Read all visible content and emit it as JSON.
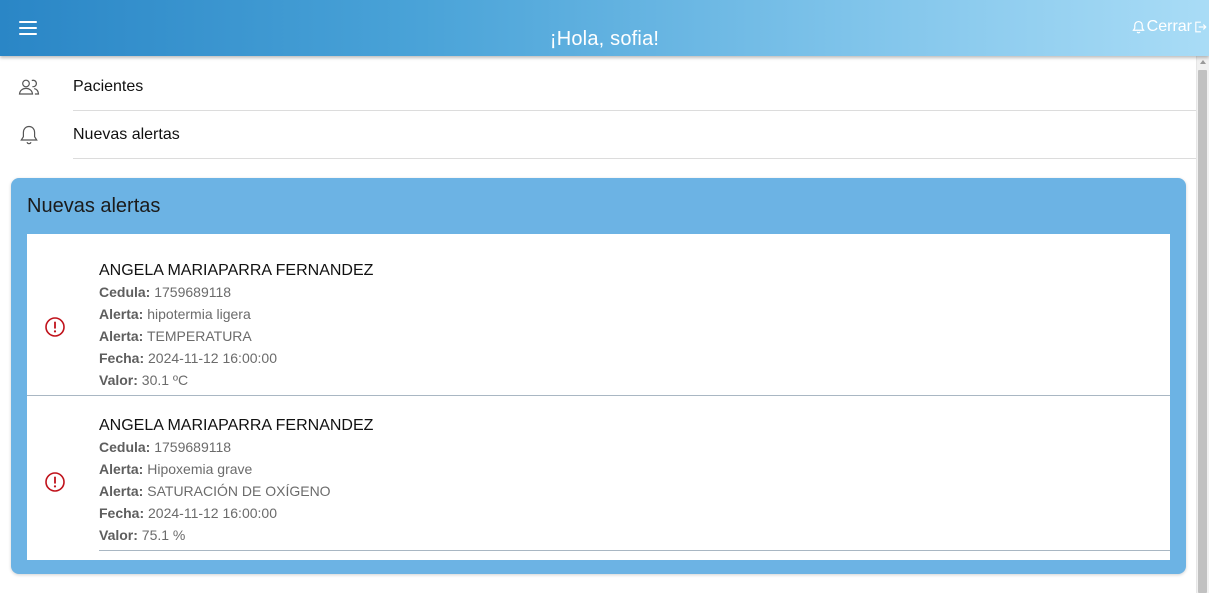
{
  "header": {
    "greeting": "¡Hola, sofia!",
    "logout_label": "Cerrar",
    "colors": {
      "gradient_start": "#2a86c6",
      "gradient_end": "#a9dcf6"
    }
  },
  "nav": {
    "items": [
      {
        "label": "Pacientes",
        "icon": "users-icon"
      },
      {
        "label": "Nuevas alertas",
        "icon": "bell-icon"
      }
    ]
  },
  "alerts_panel": {
    "title": "Nuevas alertas",
    "accent_color": "#6cb3e4",
    "alert_icon_color": "#c0121b",
    "alerts": [
      {
        "patient": "ANGELA MARIAPARRA FERNANDEZ",
        "cedula_label": "Cedula:",
        "cedula": "1759689118",
        "alerta_label": "Alerta:",
        "alerta": "hipotermia ligera",
        "tipo_label": "Alerta:",
        "tipo": "TEMPERATURA",
        "fecha_label": "Fecha:",
        "fecha": "2024-11-12 16:00:00",
        "valor_label": "Valor:",
        "valor": "30.1 ºC"
      },
      {
        "patient": "ANGELA MARIAPARRA FERNANDEZ",
        "cedula_label": "Cedula:",
        "cedula": "1759689118",
        "alerta_label": "Alerta:",
        "alerta": "Hipoxemia grave",
        "tipo_label": "Alerta:",
        "tipo": "SATURACIÓN DE OXÍGENO",
        "fecha_label": "Fecha:",
        "fecha": "2024-11-12 16:00:00",
        "valor_label": "Valor:",
        "valor": "75.1 %"
      }
    ]
  }
}
